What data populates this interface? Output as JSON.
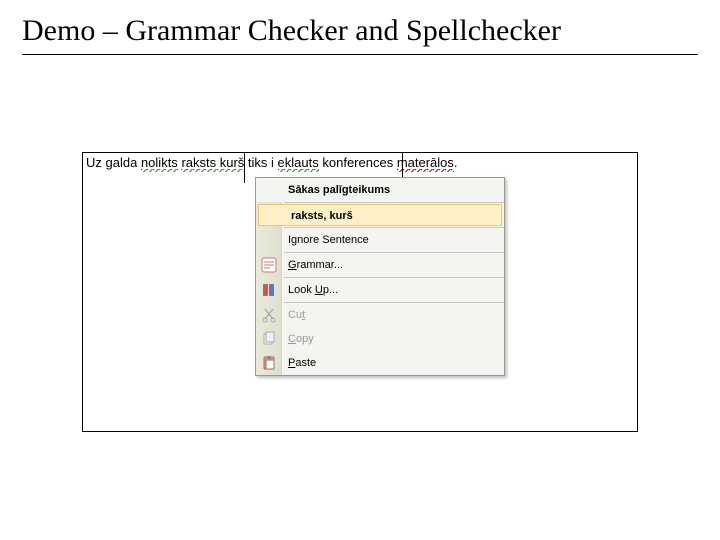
{
  "title": "Demo – Grammar Checker and Spellchecker",
  "sentence": {
    "w0": "Uz",
    "w1": "galda",
    "w2": "nolikts",
    "w3": "raksts kurš",
    "w4": "tiks",
    "w5": "i",
    "w6": "eklauts",
    "w7": "konferences",
    "w8": "materālos",
    "period": "."
  },
  "menu": {
    "header": "Sākas palīgteikums",
    "suggestion": "raksts, kurš",
    "ignore": "Ignore Sentence",
    "grammar": "Grammar...",
    "lookup": "Look Up...",
    "cut": "Cut",
    "copy": "Copy",
    "paste": "Paste"
  }
}
